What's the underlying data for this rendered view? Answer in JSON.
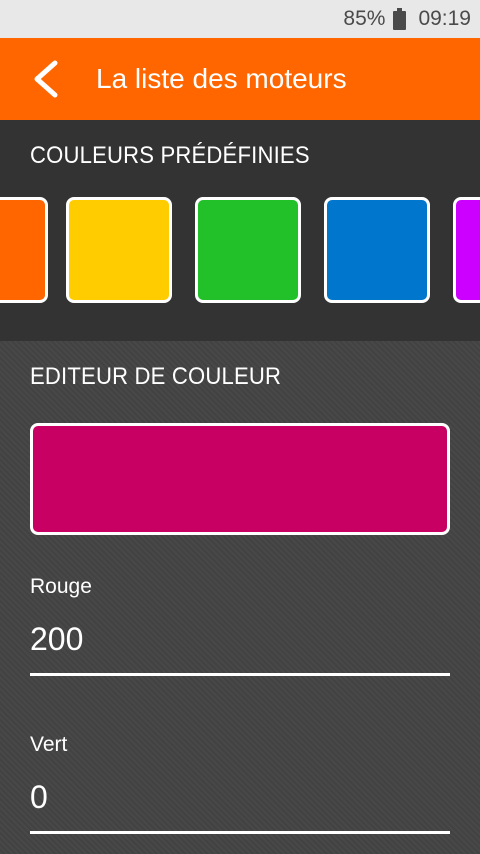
{
  "status_bar": {
    "battery_percent": "85%",
    "time": "09:19"
  },
  "app_bar": {
    "title": "La liste des moteurs",
    "back_icon": "arrow-back-icon"
  },
  "predefined": {
    "title": "COULEURS PRÉDÉFINIES",
    "swatches": [
      {
        "name": "orange",
        "color": "#ff6600"
      },
      {
        "name": "yellow",
        "color": "#ffcc00"
      },
      {
        "name": "green",
        "color": "#22c12a"
      },
      {
        "name": "blue",
        "color": "#0077cc"
      },
      {
        "name": "purple",
        "color": "#cc00ff"
      }
    ]
  },
  "editor": {
    "title": "EDITEUR DE COULEUR",
    "preview_color": "#c80064",
    "fields": [
      {
        "label": "Rouge",
        "value": "200"
      },
      {
        "label": "Vert",
        "value": "0"
      }
    ]
  },
  "colors": {
    "accent": "#ff6600",
    "status_bar": "#e8e8e8",
    "section_dark": "#333333",
    "background": "#444444"
  }
}
